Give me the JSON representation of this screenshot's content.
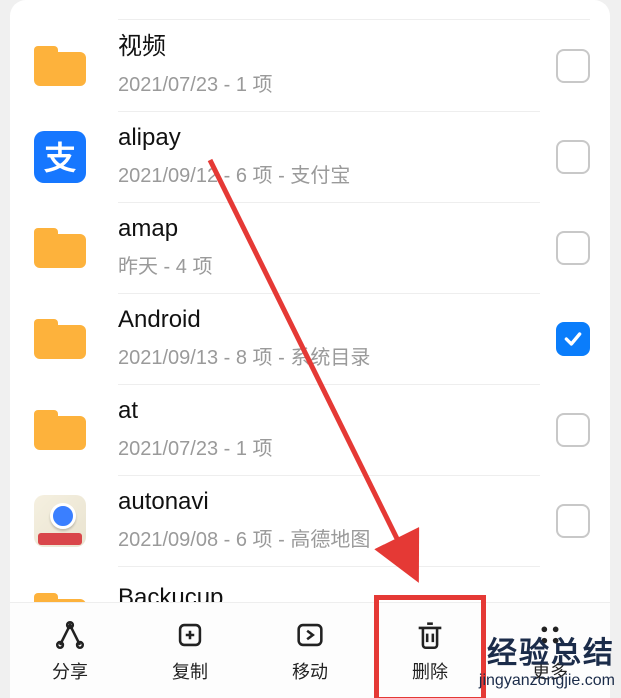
{
  "list": [
    {
      "name": "视频",
      "meta": "2021/07/23 - 1 项",
      "icon": "folder",
      "checked": false
    },
    {
      "name": "alipay",
      "meta": "2021/09/12 - 6 项 - 支付宝",
      "icon": "alipay",
      "checked": false
    },
    {
      "name": "amap",
      "meta": "昨天 - 4 项",
      "icon": "folder",
      "checked": false
    },
    {
      "name": "Android",
      "meta": "2021/09/13 - 8 项 - 系统目录",
      "icon": "folder",
      "checked": true
    },
    {
      "name": "at",
      "meta": "2021/07/23 - 1 项",
      "icon": "folder",
      "checked": false
    },
    {
      "name": "autonavi",
      "meta": "2021/09/08 - 6 项 - 高德地图",
      "icon": "autonavi",
      "checked": false
    },
    {
      "name": "Backucup",
      "meta": "",
      "icon": "folder",
      "checked": null
    }
  ],
  "toolbar": {
    "share": "分享",
    "copy": "复制",
    "move": "移动",
    "delete": "删除",
    "more": "更多"
  },
  "watermark": {
    "main": "经验总结",
    "sub": "jingyanzongjie.com"
  }
}
